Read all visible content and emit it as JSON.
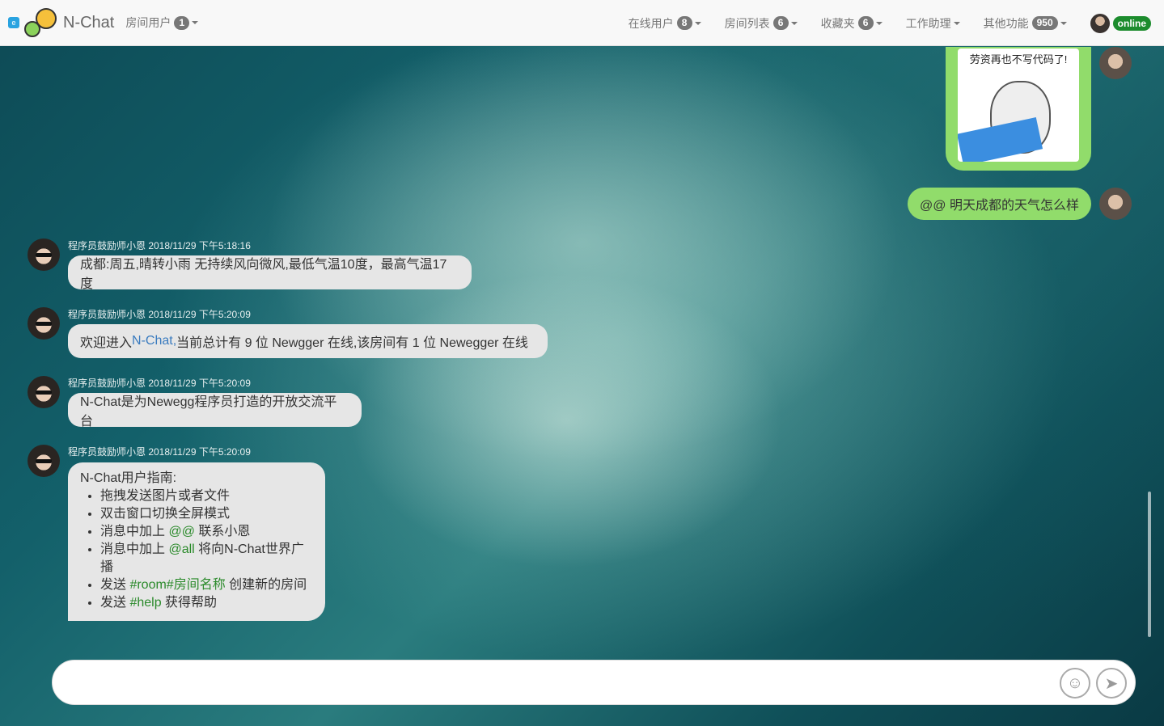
{
  "app": {
    "title": "N-Chat"
  },
  "navbar": {
    "room_users": {
      "label": "房间用户",
      "count": "1"
    },
    "online_users": {
      "label": "在线用户",
      "count": "8"
    },
    "room_list": {
      "label": "房间列表",
      "count": "6"
    },
    "favorites": {
      "label": "收藏夹",
      "count": "6"
    },
    "work_assistant": {
      "label": "工作助理"
    },
    "other_features": {
      "label": "其他功能",
      "count": "950"
    },
    "status": "online"
  },
  "messages": {
    "img_caption": "劳资再也不写代码了!",
    "right_text": "@@ 明天成都的天气怎么样",
    "m1": {
      "meta": "程序员鼓励师小恩 2018/11/29 下午5:18:16",
      "text": "成都:周五,晴转小雨 无持续风向微风,最低气温10度，最高气温17度"
    },
    "m2": {
      "meta": "程序员鼓励师小恩 2018/11/29 下午5:20:09",
      "pre": "欢迎进入 ",
      "link": "N-Chat,",
      "post": " 当前总计有 9 位 Newgger 在线,该房间有 1 位 Newegger 在线"
    },
    "m3": {
      "meta": "程序员鼓励师小恩 2018/11/29 下午5:20:09",
      "text": "N-Chat是为Newegg程序员打造的开放交流平台"
    },
    "m4": {
      "meta": "程序员鼓励师小恩 2018/11/29 下午5:20:09",
      "title": "N-Chat用户指南:",
      "items": [
        {
          "pre": "拖拽发送图片或者文件",
          "kw": "",
          "post": ""
        },
        {
          "pre": "双击窗口切换全屏模式",
          "kw": "",
          "post": ""
        },
        {
          "pre": "消息中加上 ",
          "kw": "@@",
          "post": " 联系小恩"
        },
        {
          "pre": "消息中加上 ",
          "kw": "@all",
          "post": " 将向N-Chat世界广播"
        },
        {
          "pre": "发送 ",
          "kw": "#room#房间名称",
          "post": " 创建新的房间"
        },
        {
          "pre": "发送 ",
          "kw": "#help",
          "post": " 获得帮助"
        }
      ]
    }
  },
  "composer": {
    "placeholder": ""
  }
}
